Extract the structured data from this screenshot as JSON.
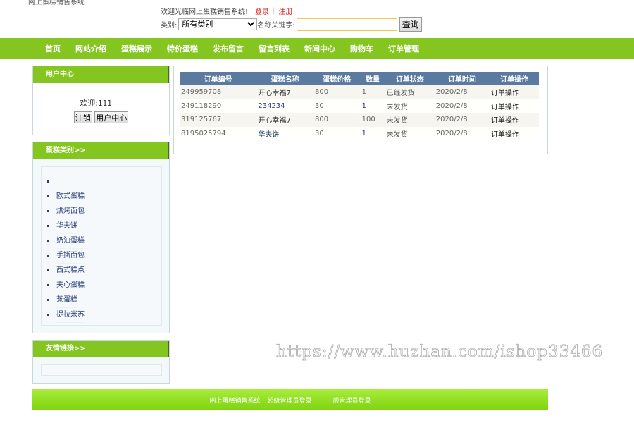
{
  "site": {
    "title": "网上蛋糕销售系统"
  },
  "top": {
    "welcome_text": "欢迎光临网上蛋糕销售系统!",
    "login_label": "登录",
    "register_label": "注册"
  },
  "search": {
    "category_label": "类别:",
    "category_selected": "所有类别",
    "keyword_label": "名称关键字:",
    "keyword_value": "",
    "keyword_placeholder": "",
    "submit_label": "查询"
  },
  "nav": {
    "items": [
      {
        "label": "首页"
      },
      {
        "label": "网站介绍"
      },
      {
        "label": "蛋糕展示"
      },
      {
        "label": "特价蛋糕"
      },
      {
        "label": "发布留言"
      },
      {
        "label": "留言列表"
      },
      {
        "label": "新闻中心"
      },
      {
        "label": "购物车"
      },
      {
        "label": "订单管理"
      }
    ]
  },
  "user_center": {
    "title": "用户中心",
    "welcome_label": "欢迎:",
    "username": "111",
    "logout_label": "注销",
    "center_label": "用户中心"
  },
  "categories": {
    "title": "蛋糕类别>>",
    "items": [
      {
        "label": ""
      },
      {
        "label": "欧式蛋糕"
      },
      {
        "label": "烘烤面包"
      },
      {
        "label": "华夫饼"
      },
      {
        "label": "奶油蛋糕"
      },
      {
        "label": "手撕面包"
      },
      {
        "label": "西式糕点"
      },
      {
        "label": "夹心蛋糕"
      },
      {
        "label": "蒸蛋糕"
      },
      {
        "label": "提拉米苏"
      }
    ]
  },
  "friend_links": {
    "title": "友情链接>>"
  },
  "orders": {
    "columns": [
      "订单编号",
      "蛋糕名称",
      "蛋糕价格",
      "数量",
      "订单状态",
      "订单时间",
      "订单操作"
    ],
    "rows": [
      {
        "id": "249959708",
        "name": "开心幸福7",
        "price": "800",
        "qty": "1",
        "status": "已经发货",
        "time": "2020/2/8",
        "action": "订单操作"
      },
      {
        "id": "249118290",
        "name": "234234",
        "price": "30",
        "qty": "1",
        "status": "未发货",
        "time": "2020/2/8",
        "action": "订单操作"
      },
      {
        "id": "319125767",
        "name": "开心幸福7",
        "price": "800",
        "qty": "100",
        "status": "未发货",
        "time": "2020/2/8",
        "action": "订单操作"
      },
      {
        "id": "8195025794",
        "name": "华夫饼",
        "price": "30",
        "qty": "1",
        "status": "未发货",
        "time": "2020/2/8",
        "action": "订单操作"
      }
    ]
  },
  "watermark": {
    "text": "https://www.huzhan.com/ishop33466"
  },
  "footer": {
    "links": [
      {
        "label": "网上蛋糕销售系统"
      },
      {
        "label": "超级管理员登录"
      },
      {
        "label": "一般管理员登录"
      }
    ]
  }
}
